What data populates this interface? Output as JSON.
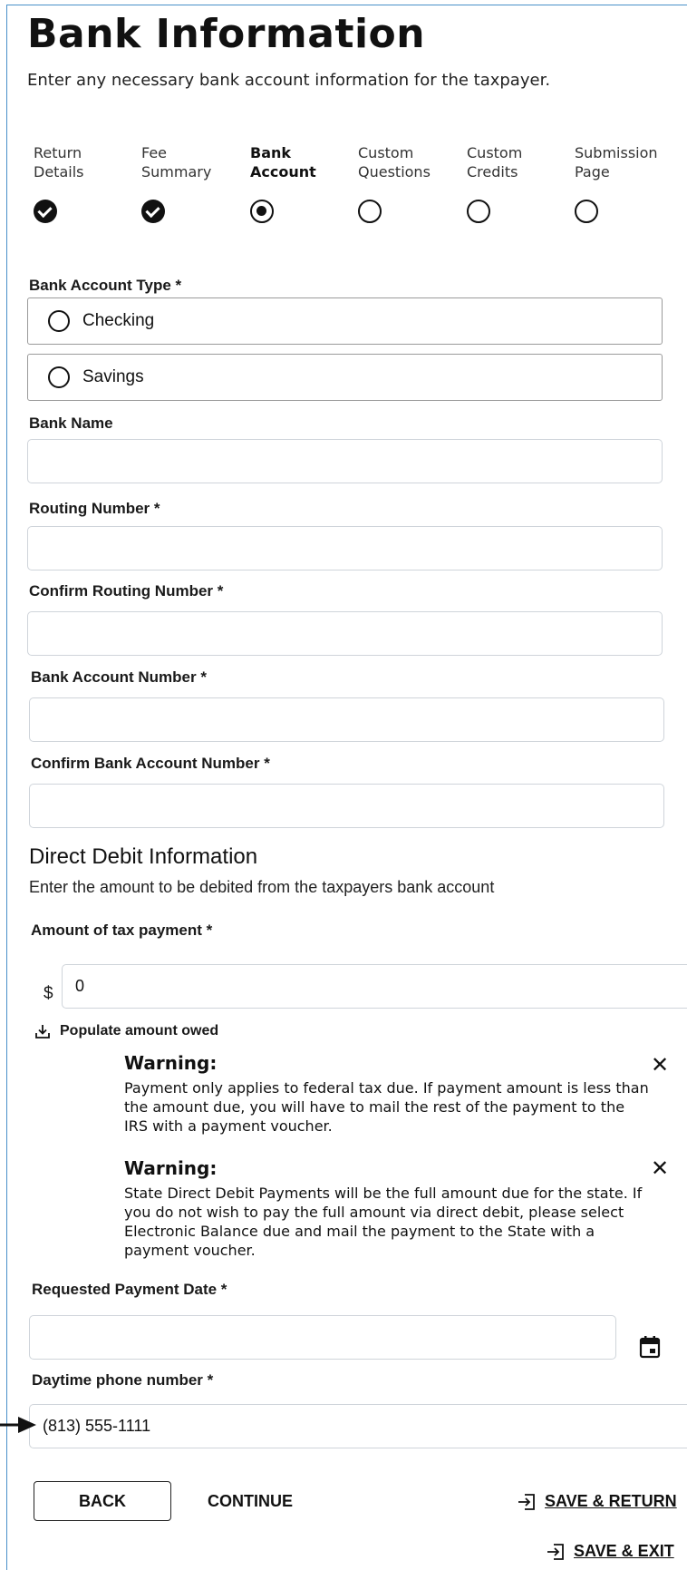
{
  "header": {
    "title": "Bank Information",
    "subtitle": "Enter any necessary bank account information for the taxpayer."
  },
  "steps": [
    {
      "label_line1": "Return",
      "label_line2": "Details",
      "status": "done"
    },
    {
      "label_line1": "Fee",
      "label_line2": "Summary",
      "status": "done"
    },
    {
      "label_line1": "Bank",
      "label_line2": "Account",
      "status": "current"
    },
    {
      "label_line1": "Custom",
      "label_line2": "Questions",
      "status": "todo"
    },
    {
      "label_line1": "Custom",
      "label_line2": "Credits",
      "status": "todo"
    },
    {
      "label_line1": "Submission",
      "label_line2": "Page",
      "status": "todo"
    }
  ],
  "account_type": {
    "label": "Bank Account Type *",
    "options": [
      "Checking",
      "Savings"
    ]
  },
  "fields": {
    "bank_name": {
      "label": "Bank Name",
      "value": ""
    },
    "routing": {
      "label": "Routing Number *",
      "value": ""
    },
    "confirm_routing": {
      "label": "Confirm Routing Number *",
      "value": ""
    },
    "account_number": {
      "label": "Bank Account Number *",
      "value": ""
    },
    "confirm_account": {
      "label": "Confirm Bank Account Number *",
      "value": ""
    }
  },
  "direct_debit": {
    "title": "Direct Debit Information",
    "description": "Enter the amount to be debited from the taxpayers bank account",
    "amount_label": "Amount of tax payment *",
    "currency": "$",
    "amount_value": "0",
    "populate_label": "Populate amount owed"
  },
  "warnings": [
    {
      "heading": "Warning:",
      "body": "Payment only applies to federal tax due. If payment amount is less than the amount due, you will have to mail the rest of the payment to the IRS with a payment voucher."
    },
    {
      "heading": "Warning:",
      "body": "State Direct Debit Payments will be the full amount due for the state. If you do not wish to pay the full amount via direct debit, please select Electronic Balance due and mail the payment to the State with a payment voucher."
    }
  ],
  "payment_date": {
    "label": "Requested Payment Date *",
    "value": ""
  },
  "phone": {
    "label": "Daytime phone number *",
    "value": "(813) 555-1111"
  },
  "actions": {
    "back": "BACK",
    "continue": "CONTINUE",
    "save_return": "SAVE & RETURN",
    "save_exit": "SAVE & EXIT"
  },
  "icons": {
    "calendar": "calendar-icon",
    "download": "download-icon",
    "close": "close-icon",
    "save": "exit-arrow-icon"
  }
}
